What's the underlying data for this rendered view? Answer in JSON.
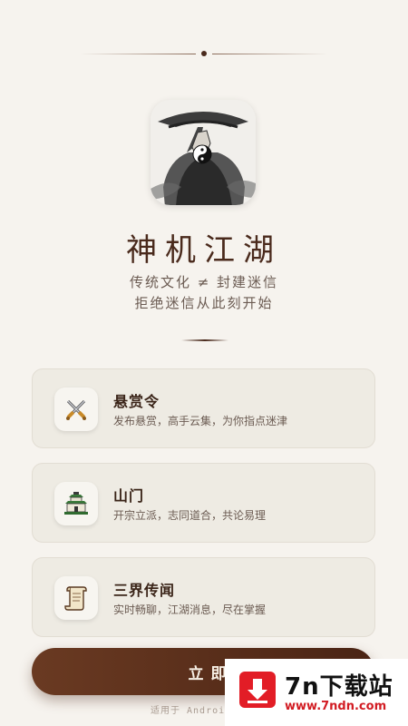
{
  "app": {
    "title": "神机江湖",
    "tagline_line1": "传统文化 ≠ 封建迷信",
    "tagline_line2": "拒绝迷信从此刻开始"
  },
  "features": [
    {
      "title": "悬赏令",
      "desc": "发布悬赏，高手云集，为你指点迷津",
      "icon": "crossed-swords-icon"
    },
    {
      "title": "山门",
      "desc": "开宗立派，志同道合，共论易理",
      "icon": "temple-gate-icon"
    },
    {
      "title": "三界传闻",
      "desc": "实时畅聊，江湖消息，尽在掌握",
      "icon": "scroll-icon"
    }
  ],
  "cta": {
    "label": "立即下"
  },
  "footer": {
    "note": "适用于 Androi"
  },
  "watermark": {
    "brand": "7n下载站",
    "url": "www.7ndn.com"
  },
  "colors": {
    "accent": "#4a2414",
    "background": "#f6f3ee",
    "card": "#eeebe3"
  }
}
